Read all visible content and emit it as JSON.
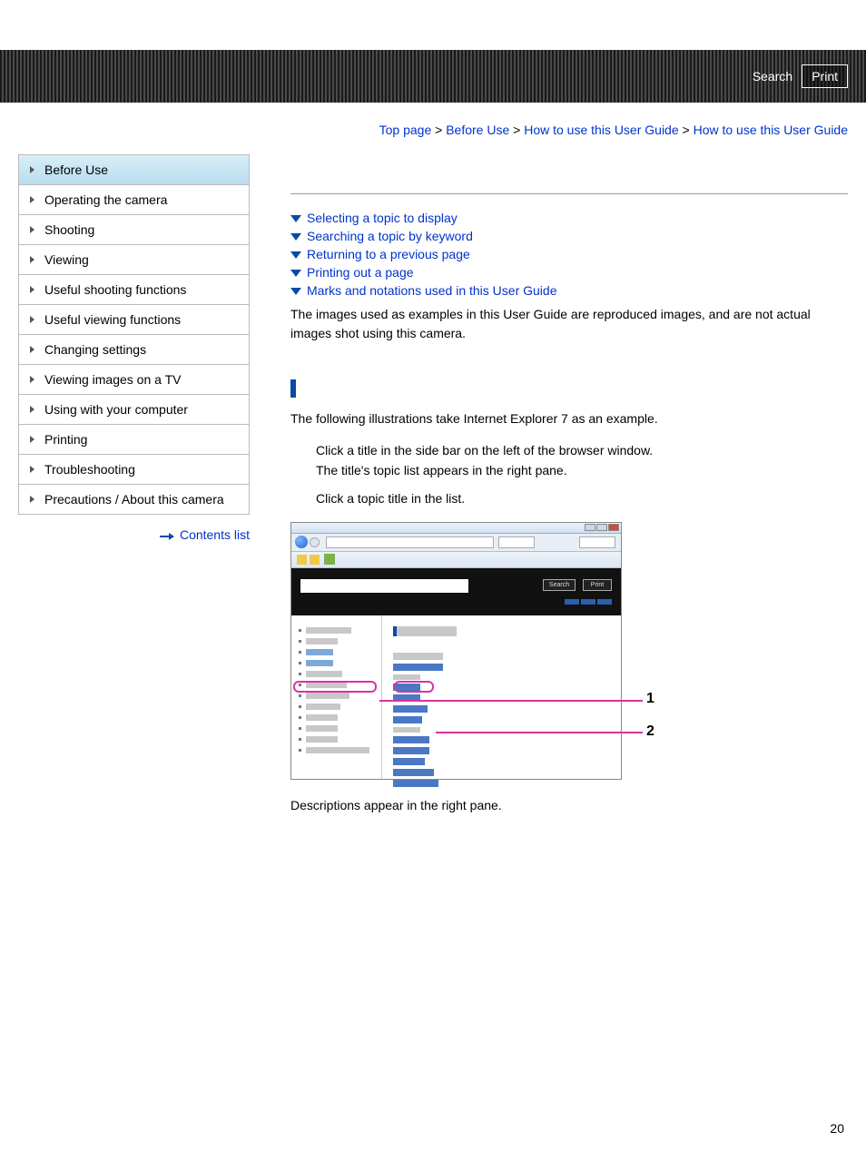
{
  "header": {
    "search_label": "Search",
    "print_label": "Print"
  },
  "breadcrumb": {
    "top": "Top page",
    "sep": ">",
    "l1": "Before Use",
    "l2": "How to use this User Guide",
    "current": "How to use this User Guide"
  },
  "sidebar": {
    "items": [
      "Before Use",
      "Operating the camera",
      "Shooting",
      "Viewing",
      "Useful shooting functions",
      "Useful viewing functions",
      "Changing settings",
      "Viewing images on a TV",
      "Using with your computer",
      "Printing",
      "Troubleshooting",
      "Precautions / About this camera"
    ],
    "contents_link": "Contents list"
  },
  "main": {
    "toc": [
      "Selecting a topic to display",
      "Searching a topic by keyword",
      "Returning to a previous page",
      "Printing out a page",
      "Marks and notations used in this User Guide"
    ],
    "note": "The images used as examples in this User Guide are reproduced images, and are not actual images shot using this camera.",
    "intro": "The following illustrations take Internet Explorer 7 as an example.",
    "step1a": "Click a title in the side bar on the left of the browser window.",
    "step1b": "The title's topic list appears in the right pane.",
    "step2": "Click a topic title in the list.",
    "after": "Descriptions appear in the right pane.",
    "callout1": "1",
    "callout2": "2",
    "btn_search": "Search",
    "btn_print": "Print"
  },
  "page_number": "20"
}
